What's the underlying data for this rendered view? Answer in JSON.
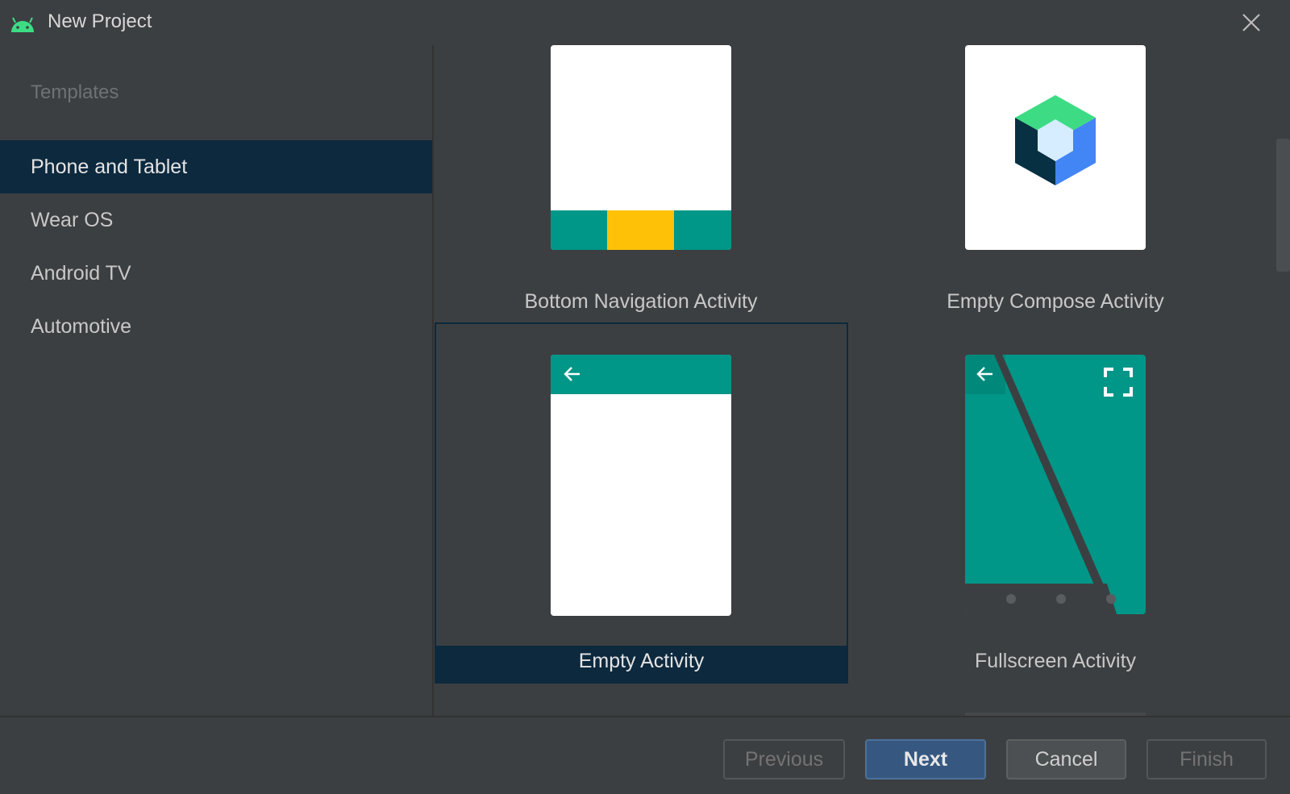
{
  "window": {
    "title": "New Project",
    "icon": "android-icon",
    "close_icon": "close-icon"
  },
  "sidebar": {
    "header": "Templates",
    "items": [
      {
        "label": "Phone and Tablet",
        "selected": true
      },
      {
        "label": "Wear OS",
        "selected": false
      },
      {
        "label": "Android TV",
        "selected": false
      },
      {
        "label": "Automotive",
        "selected": false
      }
    ]
  },
  "templates": [
    {
      "label": "Bottom Navigation Activity",
      "selected": false
    },
    {
      "label": "Empty Compose Activity",
      "selected": false
    },
    {
      "label": "Empty Activity",
      "selected": true
    },
    {
      "label": "Fullscreen Activity",
      "selected": false
    }
  ],
  "buttons": {
    "previous": "Previous",
    "next": "Next",
    "cancel": "Cancel",
    "finish": "Finish"
  },
  "colors": {
    "accent_teal": "#009688",
    "accent_yellow": "#ffc107",
    "selection": "#0d293e",
    "primary_button": "#365880",
    "compose_green": "#3ddc84",
    "compose_blue": "#4285f4"
  }
}
